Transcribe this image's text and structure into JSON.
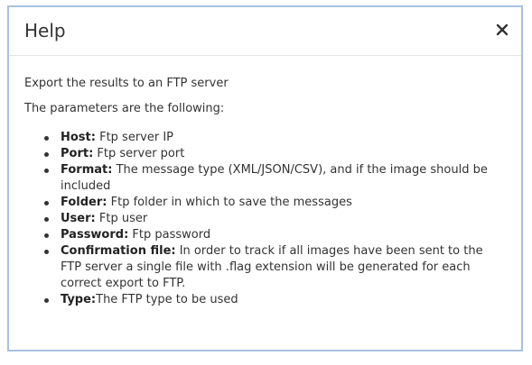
{
  "dialog": {
    "title": "Help",
    "close_icon": "close-icon"
  },
  "body": {
    "intro_line": "Export the results to an FTP server",
    "params_heading": "The parameters are the following:",
    "params": [
      {
        "term": "Host:",
        "desc": " Ftp server IP"
      },
      {
        "term": "Port:",
        "desc": " Ftp server port"
      },
      {
        "term": "Format:",
        "desc": " The message type (XML/JSON/CSV), and if the image should be included"
      },
      {
        "term": "Folder:",
        "desc": " Ftp folder in which to save the messages"
      },
      {
        "term": "User:",
        "desc": " Ftp user"
      },
      {
        "term": "Password:",
        "desc": " Ftp password"
      },
      {
        "term": "Confirmation file:",
        "desc": " In order to track if all images have been sent to the FTP server a single file with .flag extension will be generated for each correct export to FTP."
      },
      {
        "term": "Type:",
        "desc": "The FTP type to be used"
      }
    ]
  },
  "colors": {
    "border": "#a9c0e2",
    "text": "#333333"
  }
}
